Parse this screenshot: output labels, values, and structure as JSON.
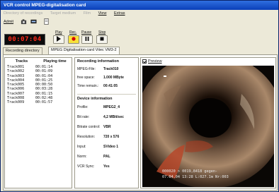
{
  "window": {
    "title": "VCR control MPEG-digitalisation card"
  },
  "menu": {
    "items": [
      {
        "label": "Directory of recordings",
        "enabled": false
      },
      {
        "label": "Target medium",
        "enabled": false
      },
      {
        "label": "Film",
        "enabled": false
      },
      {
        "label": "View",
        "enabled": true
      },
      {
        "label": "Extras",
        "enabled": true
      }
    ]
  },
  "toolbar": {
    "admit_label": "Admit"
  },
  "counter": {
    "display": "00:07:04"
  },
  "transport": {
    "play_label": "Play",
    "rec_label": "Rec.",
    "pause_label": "Pause",
    "stop_label": "Stop"
  },
  "tabs": [
    {
      "label": "Recording directory",
      "active": false
    },
    {
      "label": "MPEG Digitalisation card Vitec VM3-2",
      "active": true
    }
  ],
  "tracks": {
    "headers": {
      "track": "Tracks",
      "time": "Playing time"
    },
    "rows": [
      {
        "track": "Track001",
        "time": "00:01:14"
      },
      {
        "track": "Track002",
        "time": "00:01:09"
      },
      {
        "track": "Track003",
        "time": "00:01:04"
      },
      {
        "track": "Track004",
        "time": "00:01:25"
      },
      {
        "track": "Track005",
        "time": "00:00:50"
      },
      {
        "track": "Track006",
        "time": "00:03:28"
      },
      {
        "track": "Track007",
        "time": "00:01:15"
      },
      {
        "track": "Track008",
        "time": "00:02:48"
      },
      {
        "track": "Track009",
        "time": "00:01:57"
      }
    ]
  },
  "recording_info": {
    "title": "Recording information",
    "rows": [
      {
        "key": "MPEG-File:",
        "value": "Track010"
      },
      {
        "key": "free space:",
        "value": "1.000 MByte"
      },
      {
        "key": "Time remain.:",
        "value": "00:41:05"
      }
    ]
  },
  "device_info": {
    "title": "Device information",
    "rows": [
      {
        "key": "Profile:",
        "value": "MPEG2_4"
      },
      {
        "key": "Bit rate:",
        "value": "4,2 MBit/sec"
      },
      {
        "key": "Bitrate control:",
        "value": "VBR"
      },
      {
        "key": "Resolution:",
        "value": "720 x 576"
      },
      {
        "key": "Input:",
        "value": "SVideo 1"
      },
      {
        "key": "Norm:",
        "value": "PAL"
      },
      {
        "key": "VCR Sync:",
        "value": "Yes"
      }
    ]
  },
  "preview": {
    "label": "Preview",
    "checked": true,
    "osd_line1": "000020 > 0019,8418 gegen-",
    "osd_line2": "07.04.04 13:28 L:027.1m Nr:003"
  },
  "colors": {
    "title_bar": "#0a3fb8",
    "counter_text": "#ff2a1a",
    "record_button": "#f7e23a"
  }
}
